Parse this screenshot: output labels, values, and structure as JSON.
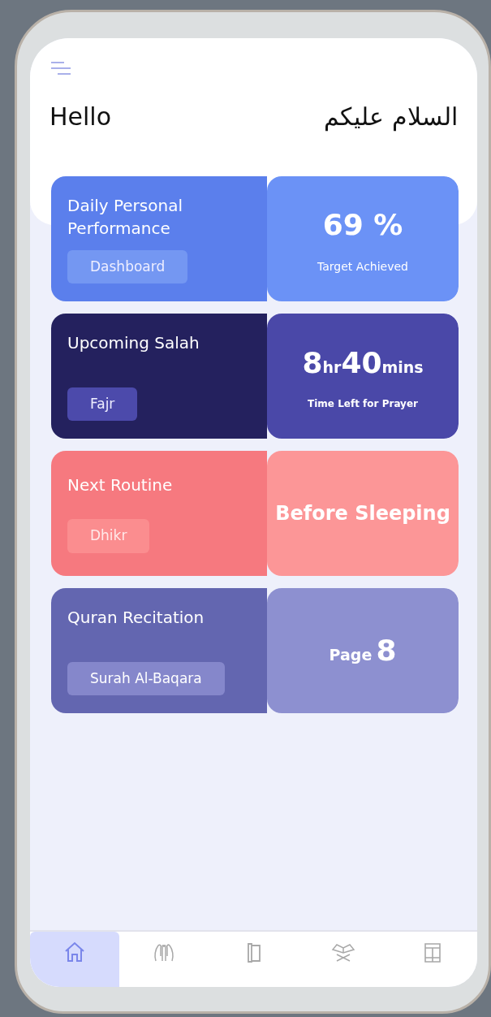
{
  "header": {
    "greeting": "Hello",
    "arabic_greeting": "السلام عليكم"
  },
  "cards": [
    {
      "kind": "performance",
      "title": "Daily Personal Performance",
      "chip": "Dashboard",
      "value_parts": [
        {
          "text": "69 %",
          "kind": "number"
        }
      ],
      "caption": "Target Achieved"
    },
    {
      "kind": "salah",
      "title": "Upcoming Salah",
      "chip": "Fajr",
      "value_parts": [
        {
          "text": "8",
          "kind": "number"
        },
        {
          "text": "hr",
          "kind": "unit"
        },
        {
          "text": "40",
          "kind": "number"
        },
        {
          "text": "mins",
          "kind": "unit"
        }
      ],
      "caption": "Time Left for Prayer"
    },
    {
      "kind": "routine",
      "title": "Next Routine",
      "chip": "Dhikr",
      "value_parts": [
        {
          "text": "Before Sleeping",
          "kind": "phrase"
        }
      ]
    },
    {
      "kind": "quran",
      "title": "Quran Recitation",
      "chip": "Surah Al-Baqara",
      "value_parts": [
        {
          "text": "Page",
          "kind": "unit"
        },
        {
          "text": "8",
          "kind": "number"
        }
      ]
    }
  ],
  "bottom_nav": [
    {
      "selected": true
    },
    {
      "selected": false
    },
    {
      "selected": false
    },
    {
      "selected": false
    },
    {
      "selected": false
    }
  ]
}
